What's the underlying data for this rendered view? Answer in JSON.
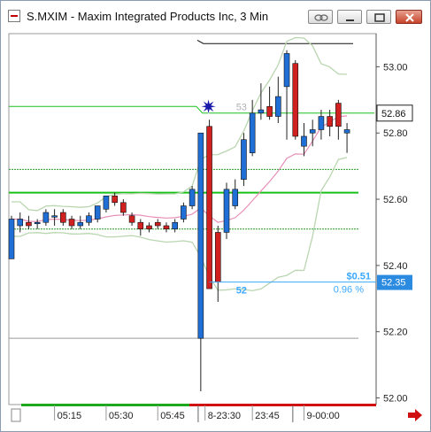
{
  "window": {
    "title": "S.MXIM - Maxim Integrated Products Inc, 3 Min",
    "buttons": [
      "link-icon",
      "minimize-icon",
      "maximize-icon",
      "close-icon"
    ]
  },
  "colors": {
    "up": "#1f6fd6",
    "down": "#d02020",
    "band": "#b9d6b0",
    "ma": "#e88fb8",
    "level": "#18c018",
    "level_dash": "#2a9a2a",
    "crosshair": "#3aa8ff",
    "price_label_bg": "#2b8be0"
  },
  "chart_data": {
    "type": "candlestick",
    "title": "S.MXIM - Maxim Integrated Products Inc, 3 Min",
    "ylim": [
      51.98,
      53.1
    ],
    "y_ticks": [
      "53.00",
      "52.80",
      "52.60",
      "52.40",
      "52.20",
      "52.00"
    ],
    "x_ticks": [
      "05:15",
      "05:30",
      "05:45",
      "8-23:30",
      "23:45",
      "9-00:00"
    ],
    "last_price": "52.86",
    "cursor_price": "52.35",
    "annotations": {
      "change_value": "$0.51",
      "change_percent": "0.96 %",
      "high_label": "53",
      "low_label": "52"
    },
    "candles": [
      {
        "o": 52.42,
        "h": 52.55,
        "l": 52.42,
        "c": 52.54
      },
      {
        "o": 52.52,
        "h": 52.56,
        "l": 52.5,
        "c": 52.54
      },
      {
        "o": 52.53,
        "h": 52.55,
        "l": 52.51,
        "c": 52.52
      },
      {
        "o": 52.53,
        "h": 52.54,
        "l": 52.51,
        "c": 52.53
      },
      {
        "o": 52.53,
        "h": 52.57,
        "l": 52.52,
        "c": 52.56
      },
      {
        "o": 52.55,
        "h": 52.57,
        "l": 52.52,
        "c": 52.55
      },
      {
        "o": 52.56,
        "h": 52.57,
        "l": 52.52,
        "c": 52.53
      },
      {
        "o": 52.54,
        "h": 52.55,
        "l": 52.51,
        "c": 52.52
      },
      {
        "o": 52.52,
        "h": 52.55,
        "l": 52.51,
        "c": 52.53
      },
      {
        "o": 52.53,
        "h": 52.56,
        "l": 52.52,
        "c": 52.55
      },
      {
        "o": 52.54,
        "h": 52.58,
        "l": 52.53,
        "c": 52.58
      },
      {
        "o": 52.57,
        "h": 52.61,
        "l": 52.56,
        "c": 52.61
      },
      {
        "o": 52.61,
        "h": 52.62,
        "l": 52.58,
        "c": 52.59
      },
      {
        "o": 52.59,
        "h": 52.6,
        "l": 52.55,
        "c": 52.56
      },
      {
        "o": 52.55,
        "h": 52.56,
        "l": 52.52,
        "c": 52.53
      },
      {
        "o": 52.53,
        "h": 52.54,
        "l": 52.49,
        "c": 52.51
      },
      {
        "o": 52.52,
        "h": 52.53,
        "l": 52.5,
        "c": 52.51
      },
      {
        "o": 52.53,
        "h": 52.54,
        "l": 52.51,
        "c": 52.52
      },
      {
        "o": 52.52,
        "h": 52.53,
        "l": 52.5,
        "c": 52.51
      },
      {
        "o": 52.51,
        "h": 52.54,
        "l": 52.5,
        "c": 52.53
      },
      {
        "o": 52.54,
        "h": 52.59,
        "l": 52.53,
        "c": 52.58
      },
      {
        "o": 52.58,
        "h": 52.64,
        "l": 52.57,
        "c": 52.63
      },
      {
        "o": 52.18,
        "h": 52.8,
        "l": 52.02,
        "c": 52.8
      },
      {
        "o": 52.82,
        "h": 52.84,
        "l": 52.33,
        "c": 52.33
      },
      {
        "o": 52.5,
        "h": 52.52,
        "l": 52.29,
        "c": 52.35
      },
      {
        "o": 52.5,
        "h": 52.65,
        "l": 52.48,
        "c": 52.63
      },
      {
        "o": 52.58,
        "h": 52.66,
        "l": 52.57,
        "c": 52.63
      },
      {
        "o": 52.66,
        "h": 52.8,
        "l": 52.64,
        "c": 52.78
      },
      {
        "o": 52.74,
        "h": 52.9,
        "l": 52.73,
        "c": 52.86
      },
      {
        "o": 52.86,
        "h": 52.95,
        "l": 52.84,
        "c": 52.87
      },
      {
        "o": 52.88,
        "h": 52.94,
        "l": 52.84,
        "c": 52.85
      },
      {
        "o": 52.85,
        "h": 52.97,
        "l": 52.83,
        "c": 52.91
      },
      {
        "o": 52.94,
        "h": 53.05,
        "l": 52.78,
        "c": 53.04
      },
      {
        "o": 53.01,
        "h": 53.02,
        "l": 52.78,
        "c": 52.79
      },
      {
        "o": 52.76,
        "h": 52.83,
        "l": 52.73,
        "c": 52.79
      },
      {
        "o": 52.8,
        "h": 52.84,
        "l": 52.76,
        "c": 52.81
      },
      {
        "o": 52.81,
        "h": 52.87,
        "l": 52.78,
        "c": 52.85
      },
      {
        "o": 52.85,
        "h": 52.87,
        "l": 52.79,
        "c": 52.82
      },
      {
        "o": 52.89,
        "h": 52.9,
        "l": 52.78,
        "c": 52.82
      },
      {
        "o": 52.8,
        "h": 52.83,
        "l": 52.74,
        "c": 52.81
      }
    ]
  }
}
